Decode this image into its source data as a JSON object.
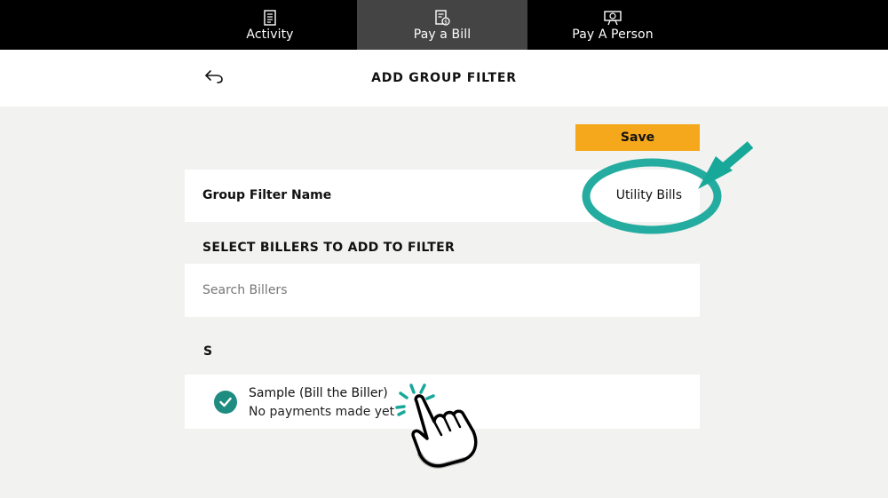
{
  "nav": {
    "tabs": [
      {
        "label": "Activity",
        "icon": "receipt-icon",
        "active": false
      },
      {
        "label": "Pay a Bill",
        "icon": "bill-dollar-icon",
        "active": true
      },
      {
        "label": "Pay A Person",
        "icon": "person-money-icon",
        "active": false
      }
    ]
  },
  "header": {
    "back_icon": "back-arrow-icon",
    "title": "ADD GROUP FILTER"
  },
  "form": {
    "save_label": "Save",
    "group_filter_name_label": "Group Filter Name",
    "group_filter_name_value": "Utility Bills",
    "select_billers_heading": "SELECT BILLERS TO ADD TO FILTER",
    "search_placeholder": "Search Billers"
  },
  "billers": {
    "letter": "S",
    "items": [
      {
        "name": "Sample (Bill the Biller)",
        "status": "No payments made yet",
        "selected": true
      }
    ]
  },
  "colors": {
    "accent": "#f5a81c",
    "check": "#1e8c80",
    "annotation": "#17a89a",
    "nav_bg": "#000000",
    "nav_active": "#444444",
    "page_bg": "#f2f2f0"
  }
}
